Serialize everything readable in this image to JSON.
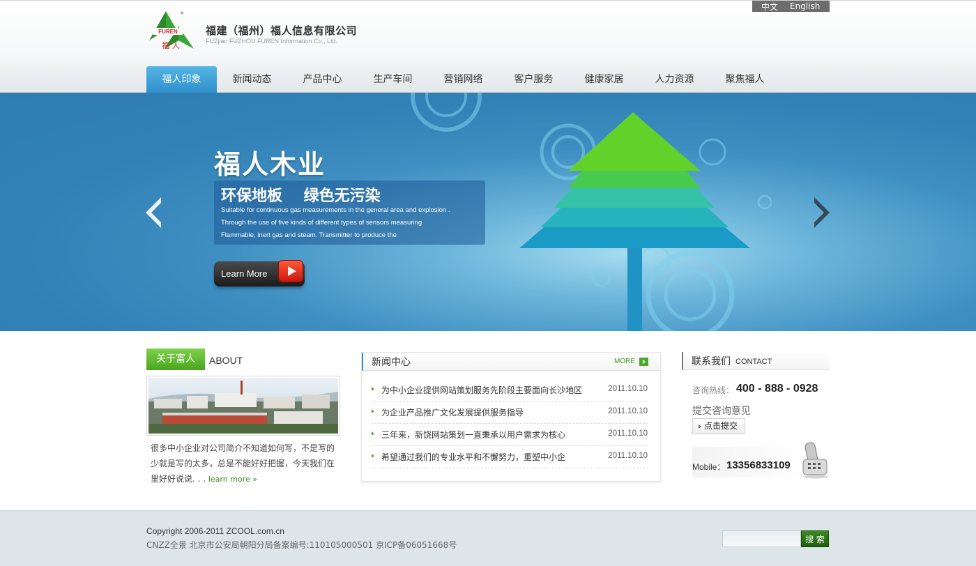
{
  "header": {
    "lang_zh": "中文",
    "lang_en": "English",
    "company_cn": "福建（福州）福人信息有限公司",
    "company_en": "FUZjian FUZHOU FUREN Information Co., Ltd.",
    "logo_text": "FUREN",
    "logo_cn": "福 人",
    "logo_mark": "®"
  },
  "nav": {
    "items": [
      {
        "label": "福人印象",
        "active": true
      },
      {
        "label": "新闻动态"
      },
      {
        "label": "产品中心"
      },
      {
        "label": "生产车间"
      },
      {
        "label": "营销网络"
      },
      {
        "label": "客户服务"
      },
      {
        "label": "健康家居"
      },
      {
        "label": "人力资源"
      },
      {
        "label": "聚焦福人"
      }
    ]
  },
  "banner": {
    "title": "福人木业",
    "subtitle": "环保地板    绿色无污染",
    "desc_lines": [
      "Suitable for continuous gas measurements in the general area and explosion .",
      "Through the use of five kinds of different types of sensors measuring",
      "Flammable, inert gas and steam. Transmitter to produce the"
    ],
    "learn_more": "Learn More"
  },
  "about": {
    "tab": "关于富人",
    "en": "ABOUT",
    "text": "很多中小企业对公司简介不知道如何写，不是写的少就是写的太多，总是不能好好把握，今天我们在里好好说说. . . ",
    "more": "learn more »"
  },
  "news": {
    "title": "新闻中心",
    "more": "MORE",
    "items": [
      {
        "title": "为中小企业提供网站策划服务先阶段主要面向长沙地区",
        "date": "2011.10.10"
      },
      {
        "title": "为企业产品推广文化发展提供服务指导",
        "date": "2011.10.10"
      },
      {
        "title": "三年来，新饶网站策划一直秉承以用户需求为核心",
        "date": "2011.10.10"
      },
      {
        "title": "希望通过我们的专业水平和不懈努力，重塑中小企",
        "date": "2011.10.10"
      }
    ]
  },
  "contact": {
    "title": "联系我们",
    "en": "CONTACT",
    "hotline_label": "咨询热线：",
    "hotline_value": "400 - 888 - 0928",
    "consult_label": "提交咨询意见",
    "submit": "点击提交",
    "mobile_label": "Mobile：",
    "mobile_value": "13356833109"
  },
  "footer": {
    "copyright": "Copyright 2006-2011 ZCOOL.com.cn",
    "icp": "CNZZ全景 北京市公安局朝阳分局备案编号:110105000501  京ICP备06051668号",
    "search_placeholder": "",
    "search_button": "搜 索"
  },
  "colors": {
    "nav_active": "#2f8fca",
    "accent_green": "#4ba51f",
    "banner_blue": "#3180b6"
  }
}
